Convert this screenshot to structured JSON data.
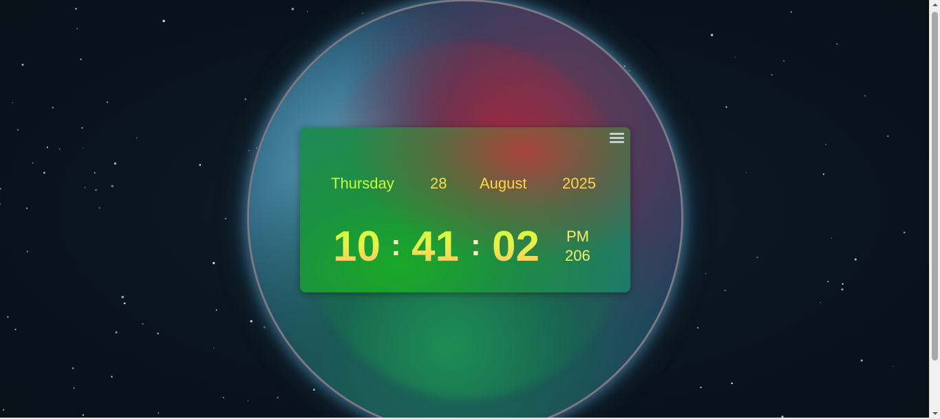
{
  "clock": {
    "weekday": "Thursday",
    "day": "28",
    "month": "August",
    "year": "2025",
    "hours": "10",
    "minutes": "41",
    "seconds": "02",
    "separator": ":",
    "meridiem": "PM",
    "day_of_year": "206"
  },
  "menu": {
    "icon": "hamburger-menu-icon"
  },
  "colors": {
    "weekday": "#c6ff3c",
    "date_text": "#ffd54a",
    "meridiem": "#f5f06a",
    "menu_icon": "#c8d0d4"
  },
  "background": {
    "scene": "planet-in-space"
  }
}
